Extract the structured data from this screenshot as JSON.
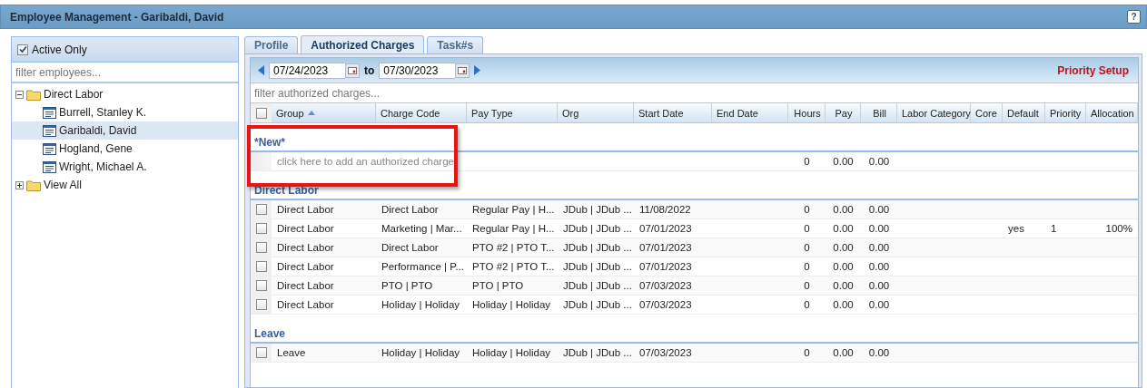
{
  "window": {
    "title": "Employee Management - Garibaldi, David",
    "help": "?"
  },
  "sidebar": {
    "active_only": {
      "label": "Active Only",
      "checked": true
    },
    "filter": {
      "placeholder": "filter employees..."
    },
    "tree": [
      {
        "kind": "folder",
        "label": "Direct Labor",
        "expanded": true,
        "selected": false,
        "children": [
          {
            "kind": "employee",
            "label": "Burrell, Stanley K.",
            "selected": false
          },
          {
            "kind": "employee",
            "label": "Garibaldi, David",
            "selected": true
          },
          {
            "kind": "employee",
            "label": "Hogland, Gene",
            "selected": false
          },
          {
            "kind": "employee",
            "label": "Wright, Michael A.",
            "selected": false
          }
        ]
      },
      {
        "kind": "folder",
        "label": "View All",
        "expanded": false,
        "selected": false
      }
    ]
  },
  "tabs": [
    {
      "label": "Profile",
      "selected": false
    },
    {
      "label": "Authorized Charges",
      "selected": true
    },
    {
      "label": "Task#s",
      "selected": false
    }
  ],
  "toolbar": {
    "from": "07/24/2023",
    "to_label": "to",
    "to": "07/30/2023",
    "priority_setup": "Priority Setup"
  },
  "filter": {
    "placeholder": "filter authorized charges..."
  },
  "table": {
    "select_all": {
      "checked": false
    },
    "columns": [
      {
        "label": "Group",
        "sorted": true
      },
      {
        "label": "Charge Code",
        "sorted": false
      },
      {
        "label": "Pay Type",
        "sorted": false
      },
      {
        "label": "Org",
        "sorted": false
      },
      {
        "label": "Start Date",
        "sorted": false
      },
      {
        "label": "End Date",
        "sorted": false
      },
      {
        "label": "Hours",
        "sorted": false
      },
      {
        "label": "Pay",
        "sorted": false
      },
      {
        "label": "Bill",
        "sorted": false
      },
      {
        "label": "Labor Category",
        "sorted": false
      },
      {
        "label": "Core",
        "sorted": false
      },
      {
        "label": "Default",
        "sorted": false
      },
      {
        "label": "Priority",
        "sorted": false
      },
      {
        "label": "Allocation",
        "sorted": false
      }
    ],
    "groups": [
      {
        "title": "*New*",
        "add_row": {
          "text": "click here to add an authorized charge",
          "hours": "0",
          "pay": "0.00",
          "bill": "0.00"
        }
      },
      {
        "title": "Direct Labor",
        "rows": [
          {
            "checked": false,
            "cells": [
              "Direct Labor",
              "Direct Labor",
              "Regular Pay | H...",
              "JDub | JDub ...",
              "11/08/2022",
              null,
              "0",
              "0.00",
              "0.00",
              null,
              null,
              null,
              null,
              null
            ]
          },
          {
            "checked": false,
            "cells": [
              "Direct Labor",
              "Marketing | Mar...",
              "Regular Pay | H...",
              "JDub | JDub ...",
              "07/01/2023",
              null,
              "0",
              "0.00",
              "0.00",
              null,
              null,
              "yes",
              "1",
              "100%"
            ]
          },
          {
            "checked": false,
            "cells": [
              "Direct Labor",
              "Direct Labor",
              "PTO #2 | PTO T...",
              "JDub | JDub ...",
              "07/01/2023",
              null,
              "0",
              "0.00",
              "0.00",
              null,
              null,
              null,
              null,
              null
            ]
          },
          {
            "checked": false,
            "cells": [
              "Direct Labor",
              "Performance | P...",
              "PTO #2 | PTO T...",
              "JDub | JDub ...",
              "07/01/2023",
              null,
              "0",
              "0.00",
              "0.00",
              null,
              null,
              null,
              null,
              null
            ]
          },
          {
            "checked": false,
            "cells": [
              "Direct Labor",
              "PTO | PTO",
              "PTO | PTO",
              "JDub | JDub ...",
              "07/03/2023",
              null,
              "0",
              "0.00",
              "0.00",
              null,
              null,
              null,
              null,
              null
            ]
          },
          {
            "checked": false,
            "cells": [
              "Direct Labor",
              "Holiday | Holiday",
              "Holiday | Holiday",
              "JDub | JDub ...",
              "07/03/2023",
              null,
              "0",
              "0.00",
              "0.00",
              null,
              null,
              null,
              null,
              null
            ]
          }
        ]
      },
      {
        "title": "Leave",
        "rows": [
          {
            "checked": false,
            "cells": [
              "Leave",
              "Holiday | Holiday",
              "Holiday | Holiday",
              "JDub | JDub ...",
              "07/03/2023",
              null,
              "0",
              "0.00",
              "0.00",
              null,
              null,
              null,
              null,
              null
            ]
          }
        ]
      }
    ]
  },
  "annotation": {
    "kind": "highlight"
  }
}
